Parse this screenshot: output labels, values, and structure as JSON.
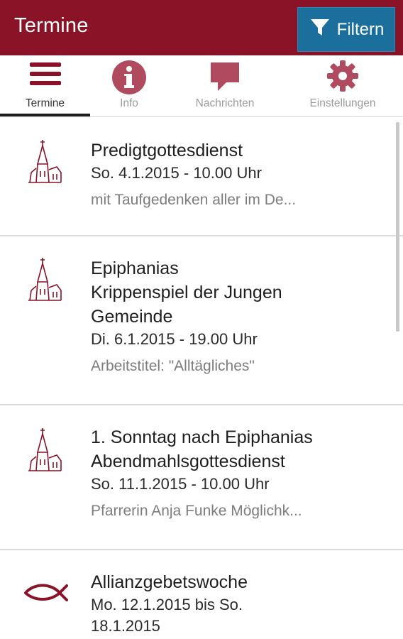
{
  "header": {
    "title": "Termine",
    "filter_label": "Filtern"
  },
  "tabs": [
    {
      "label": "Termine",
      "icon": "menu-icon"
    },
    {
      "label": "Info",
      "icon": "info-icon"
    },
    {
      "label": "Nachrichten",
      "icon": "chat-icon"
    },
    {
      "label": "Einstellungen",
      "icon": "gear-icon"
    }
  ],
  "events": [
    {
      "icon": "church-icon",
      "title_lines": [
        "Predigtgottesdienst"
      ],
      "date": "So. 4.1.2015 - 10.00 Uhr",
      "desc": "mit Taufgedenken aller im De..."
    },
    {
      "icon": "church-icon",
      "title_lines": [
        "Epiphanias",
        "Krippenspiel der Jungen",
        "Gemeinde"
      ],
      "date": "Di. 6.1.2015 - 19.00 Uhr",
      "desc": "Arbeitstitel: \"Alltägliches\""
    },
    {
      "icon": "church-icon",
      "title_lines": [
        "1. Sonntag nach Epiphanias",
        "Abendmahlsgottesdienst"
      ],
      "date": "So. 11.1.2015 - 10.00 Uhr",
      "desc": "Pfarrerin Anja Funke Möglichk..."
    },
    {
      "icon": "fish-icon",
      "title_lines": [
        "Allianzgebetswoche"
      ],
      "date_lines": [
        "Mo. 12.1.2015  bis So.",
        "18.1.2015"
      ]
    }
  ],
  "colors": {
    "brand": "#8a1328",
    "accent": "#1b6f9c"
  }
}
